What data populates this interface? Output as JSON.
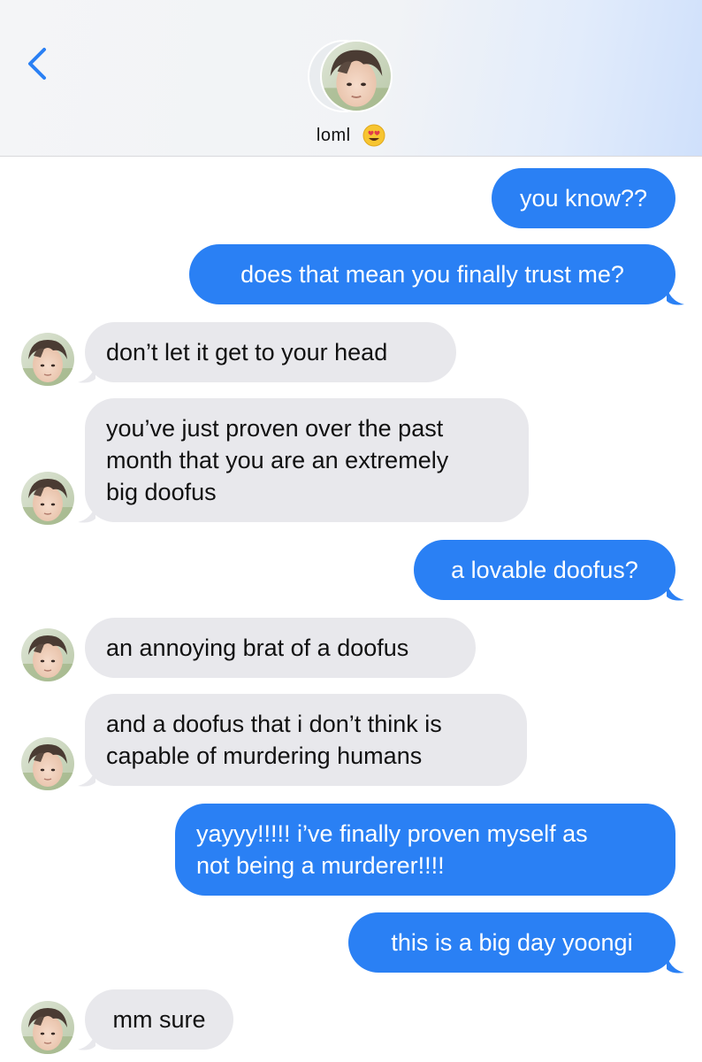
{
  "header": {
    "contact_name": "loml",
    "contact_emoji": "heart-eyes-emoji",
    "back_icon": "chevron-left-icon",
    "colors": {
      "accent": "#2a80f4",
      "incoming": "#e8e8ec"
    }
  },
  "messages": [
    {
      "direction": "outgoing",
      "text": "you know??"
    },
    {
      "direction": "outgoing",
      "text": "does that mean you finally trust me?"
    },
    {
      "direction": "incoming",
      "text": "don’t let it get to your head"
    },
    {
      "direction": "incoming",
      "lines": [
        "you’ve just proven over the past",
        "month that you are an extremely",
        "big doofus"
      ]
    },
    {
      "direction": "outgoing",
      "text": "a lovable doofus?"
    },
    {
      "direction": "incoming",
      "text": "an annoying brat of a doofus"
    },
    {
      "direction": "incoming",
      "lines": [
        "and a doofus that i don’t think is",
        "capable of murdering humans"
      ]
    },
    {
      "direction": "outgoing",
      "lines": [
        "yayyy!!!!! i’ve finally proven myself as",
        "not being a murderer!!!!"
      ]
    },
    {
      "direction": "outgoing",
      "text": "this is a big day yoongi"
    },
    {
      "direction": "incoming",
      "text": "mm sure"
    }
  ]
}
